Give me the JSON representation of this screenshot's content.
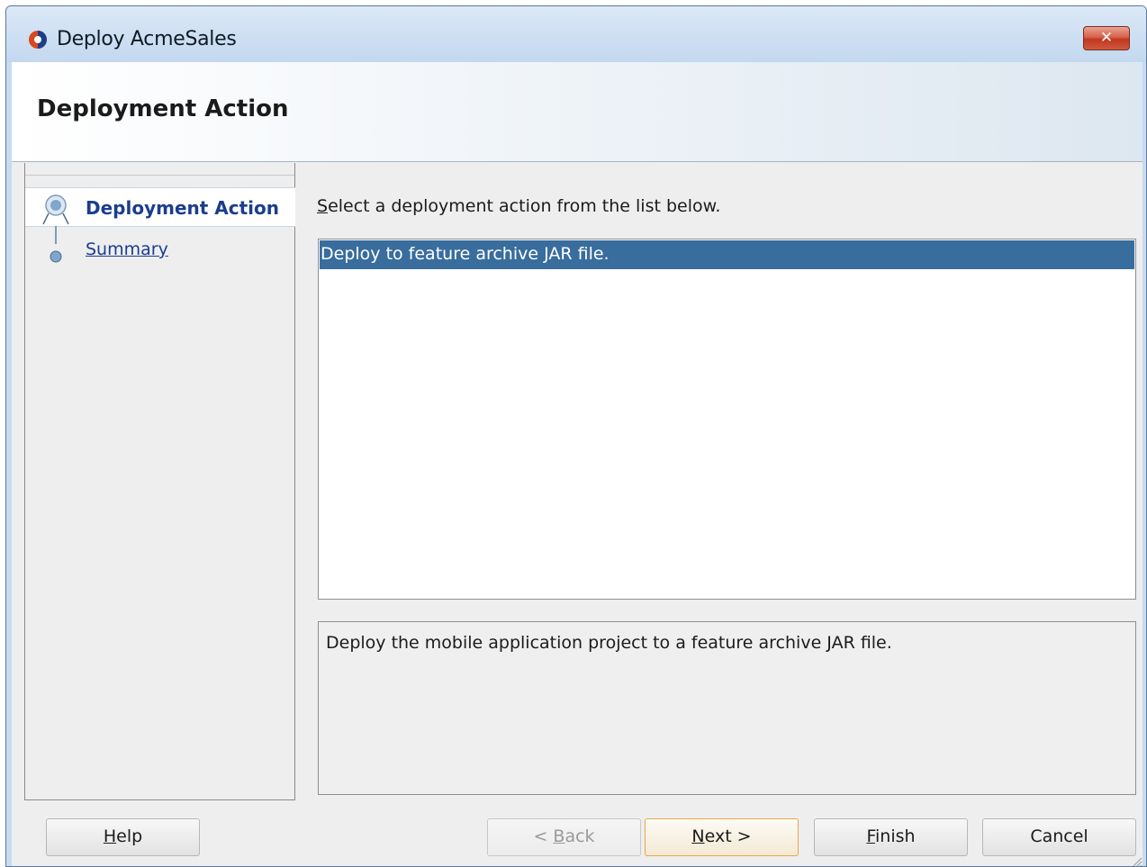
{
  "window": {
    "title": "Deploy AcmeSales",
    "close_label": "✕"
  },
  "header": {
    "title": "Deployment Action"
  },
  "steps": [
    {
      "label": "Deployment Action",
      "state": "active"
    },
    {
      "label": "Summary",
      "state": "link"
    }
  ],
  "main": {
    "instruction_mnemonic": "S",
    "instruction_rest": "elect a deployment action from the list below.",
    "actions": [
      {
        "label": "Deploy to feature archive JAR file.",
        "selected": true
      }
    ],
    "description": "Deploy the mobile application project to a feature archive JAR file."
  },
  "buttons": {
    "help": {
      "mnemonic": "H",
      "rest": "elp"
    },
    "back": {
      "prefix": "< ",
      "mnemonic": "B",
      "rest": "ack",
      "disabled": true
    },
    "next": {
      "mnemonic": "N",
      "rest": "ext >",
      "default": true
    },
    "finish": {
      "mnemonic": "F",
      "rest": "inish"
    },
    "cancel": {
      "label": "Cancel"
    }
  },
  "colors": {
    "selection": "#386d9d",
    "link": "#1b3d8f",
    "close_button": "#c2371f",
    "default_button_border": "#e5a94b"
  },
  "icons": {
    "app": "oracle-jdeveloper-icon",
    "active_step": "step-active-icon",
    "pending_step": "step-pending-icon",
    "close": "close-icon",
    "resize": "resize-grip-icon"
  }
}
